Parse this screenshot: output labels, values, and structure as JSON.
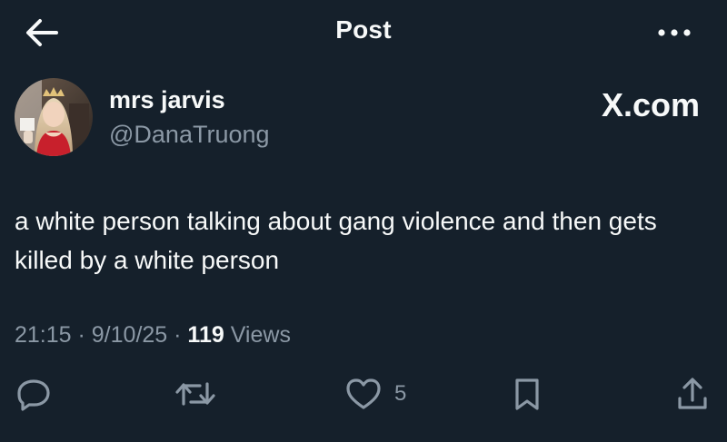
{
  "header": {
    "title": "Post",
    "back_icon": "arrow-left-icon",
    "more_icon": "more-horizontal-icon"
  },
  "author": {
    "display_name": "mrs jarvis",
    "handle": "@DanaTruong",
    "avatar": "user-avatar-photo"
  },
  "watermark": "X.com",
  "tweet": {
    "text": "a white person talking about gang violence and then gets killed by a white person"
  },
  "meta": {
    "time": "21:15",
    "separator1": " · ",
    "date": "9/10/25",
    "separator2": " · ",
    "views_count": "119",
    "views_label": " Views"
  },
  "actions": {
    "reply_icon": "reply-icon",
    "repost_icon": "repost-icon",
    "like_icon": "heart-icon",
    "like_count": "5",
    "bookmark_icon": "bookmark-icon",
    "share_icon": "share-icon"
  },
  "colors": {
    "background": "#15202b",
    "text_primary": "#f7f9f9",
    "text_secondary": "#8b98a5"
  }
}
